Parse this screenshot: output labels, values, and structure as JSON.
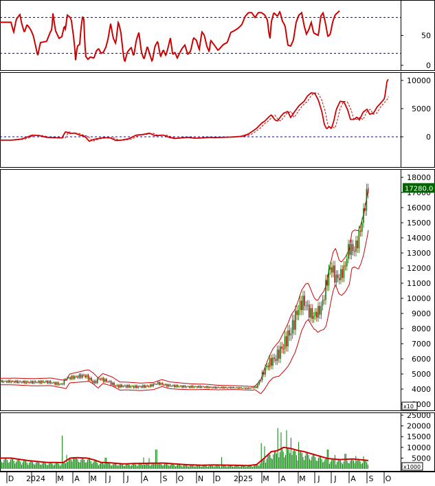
{
  "colors": {
    "line": "#cc0000",
    "guide": "#00008b",
    "up": "#008000",
    "down": "#cc0000",
    "axis": "#000000",
    "price_tag_bg": "#006400",
    "price_tag_fg": "#ffffff"
  },
  "x_axis": {
    "labels": [
      "D",
      "2024",
      "M",
      "A",
      "M",
      "J",
      "J",
      "A",
      "S",
      "O",
      "N",
      "D",
      "2025",
      "M",
      "A",
      "M",
      "J",
      "J",
      "A",
      "S",
      "O"
    ]
  },
  "chart_data": [
    {
      "type": "line",
      "name": "oscillator",
      "ylim": [
        0,
        100
      ],
      "yticks": [
        0,
        50
      ],
      "guides": [
        20,
        80
      ],
      "anchors": [
        [
          0,
          72
        ],
        [
          0.015,
          55
        ],
        [
          0.03,
          77
        ],
        [
          0.05,
          85
        ],
        [
          0.06,
          70
        ],
        [
          0.075,
          55
        ],
        [
          0.09,
          68
        ],
        [
          0.11,
          60
        ],
        [
          0.125,
          50
        ],
        [
          0.14,
          30
        ],
        [
          0.15,
          16
        ],
        [
          0.165,
          38
        ],
        [
          0.2,
          40
        ],
        [
          0.22,
          55
        ],
        [
          0.23,
          60
        ],
        [
          0.235,
          88
        ],
        [
          0.25,
          58
        ],
        [
          0.27,
          45
        ],
        [
          0.29,
          48
        ],
        [
          0.31,
          66
        ],
        [
          0.32,
          60
        ],
        [
          0.335,
          84
        ],
        [
          0.36,
          80
        ],
        [
          0.37,
          75
        ],
        [
          0.39,
          45
        ],
        [
          0.4,
          25
        ],
        [
          0.405,
          8
        ],
        [
          0.42,
          32
        ],
        [
          0.44,
          35
        ],
        [
          0.45,
          60
        ],
        [
          0.465,
          83
        ],
        [
          0.475,
          76
        ],
        [
          0.48,
          50
        ],
        [
          0.49,
          15
        ],
        [
          0.51,
          10
        ],
        [
          0.52,
          12
        ],
        [
          0.53,
          14
        ],
        [
          0.56,
          12
        ],
        [
          0.58,
          24
        ],
        [
          0.6,
          28
        ],
        [
          0.62,
          20
        ],
        [
          0.64,
          22
        ],
        [
          0.66,
          30
        ],
        [
          0.68,
          45
        ],
        [
          0.7,
          70
        ],
        [
          0.72,
          46
        ],
        [
          0.74,
          36
        ],
        [
          0.76,
          73
        ],
        [
          0.78,
          55
        ],
        [
          0.8,
          16
        ],
        [
          0.81,
          5
        ],
        [
          0.83,
          22
        ],
        [
          0.86,
          30
        ],
        [
          0.88,
          15
        ],
        [
          0.9,
          42
        ],
        [
          0.92,
          55
        ],
        [
          0.94,
          22
        ],
        [
          0.96,
          10
        ],
        [
          0.97,
          18
        ],
        [
          0.985,
          32
        ],
        [
          1.0,
          20
        ],
        [
          1.02,
          6
        ],
        [
          1.04,
          32
        ],
        [
          1.06,
          40
        ],
        [
          1.08,
          14
        ],
        [
          1.1,
          26
        ],
        [
          1.12,
          16
        ],
        [
          1.14,
          30
        ],
        [
          1.16,
          46
        ],
        [
          1.18,
          18
        ],
        [
          1.2,
          22
        ],
        [
          1.22,
          12
        ],
        [
          1.24,
          20
        ],
        [
          1.26,
          28
        ],
        [
          1.28,
          34
        ],
        [
          1.3,
          18
        ],
        [
          1.32,
          24
        ],
        [
          1.34,
          46
        ],
        [
          1.36,
          42
        ],
        [
          1.38,
          26
        ],
        [
          1.4,
          56
        ],
        [
          1.42,
          50
        ],
        [
          1.44,
          32
        ],
        [
          1.46,
          22
        ],
        [
          1.47,
          42
        ],
        [
          1.5,
          34
        ],
        [
          1.53,
          25
        ],
        [
          1.56,
          35
        ],
        [
          1.58,
          38
        ],
        [
          1.6,
          55
        ],
        [
          1.62,
          58
        ],
        [
          1.64,
          62
        ],
        [
          1.66,
          68
        ],
        [
          1.68,
          82
        ],
        [
          1.7,
          88
        ],
        [
          1.72,
          88
        ],
        [
          1.74,
          80
        ],
        [
          1.76,
          88
        ],
        [
          1.78,
          88
        ],
        [
          1.8,
          84
        ],
        [
          1.82,
          75
        ],
        [
          1.83,
          55
        ],
        [
          1.84,
          44
        ],
        [
          1.85,
          72
        ],
        [
          1.87,
          88
        ],
        [
          1.9,
          82
        ],
        [
          1.92,
          90
        ],
        [
          1.94,
          74
        ],
        [
          1.96,
          66
        ],
        [
          1.98,
          34
        ],
        [
          2.0,
          32
        ],
        [
          2.02,
          42
        ],
        [
          2.04,
          72
        ],
        [
          2.06,
          84
        ],
        [
          2.08,
          88
        ],
        [
          2.1,
          66
        ],
        [
          2.12,
          52
        ],
        [
          2.14,
          60
        ],
        [
          2.16,
          72
        ],
        [
          2.18,
          54
        ],
        [
          2.2,
          52
        ],
        [
          2.22,
          50
        ],
        [
          2.24,
          82
        ],
        [
          2.26,
          88
        ],
        [
          2.28,
          70
        ],
        [
          2.3,
          48
        ],
        [
          2.32,
          52
        ],
        [
          2.34,
          72
        ],
        [
          2.36,
          84
        ],
        [
          2.38,
          88
        ],
        [
          2.4,
          92
        ]
      ]
    },
    {
      "type": "line",
      "name": "momentum",
      "ylim": [
        -5000,
        10000
      ],
      "yticks": [
        0,
        5000,
        10000
      ],
      "guides": [
        0
      ],
      "anchors": [
        [
          0,
          -600
        ],
        [
          0.06,
          -400
        ],
        [
          0.12,
          300
        ],
        [
          0.16,
          200
        ],
        [
          0.2,
          -100
        ],
        [
          0.24,
          -150
        ],
        [
          0.29,
          -200
        ],
        [
          0.32,
          900
        ],
        [
          0.36,
          600
        ],
        [
          0.4,
          650
        ],
        [
          0.44,
          300
        ],
        [
          0.48,
          100
        ],
        [
          0.5,
          -300
        ],
        [
          0.52,
          -800
        ],
        [
          0.56,
          -450
        ],
        [
          0.6,
          -300
        ],
        [
          0.64,
          -150
        ],
        [
          0.7,
          -200
        ],
        [
          0.74,
          -650
        ],
        [
          0.78,
          -600
        ],
        [
          0.84,
          -350
        ],
        [
          0.9,
          300
        ],
        [
          0.95,
          400
        ],
        [
          1.0,
          650
        ],
        [
          1.04,
          200
        ],
        [
          1.1,
          300
        ],
        [
          1.15,
          -100
        ],
        [
          1.2,
          -300
        ],
        [
          1.25,
          -200
        ],
        [
          1.3,
          -100
        ],
        [
          1.35,
          -250
        ],
        [
          1.4,
          -200
        ],
        [
          1.45,
          -100
        ],
        [
          1.5,
          -150
        ],
        [
          1.55,
          -100
        ],
        [
          1.6,
          -50
        ],
        [
          1.65,
          50
        ],
        [
          1.67,
          200
        ],
        [
          1.7,
          500
        ],
        [
          1.75,
          1500
        ],
        [
          1.78,
          2400
        ],
        [
          1.8,
          2800
        ],
        [
          1.83,
          3500
        ],
        [
          1.85,
          3900
        ],
        [
          1.88,
          3000
        ],
        [
          1.9,
          2800
        ],
        [
          1.93,
          3700
        ],
        [
          1.95,
          4200
        ],
        [
          1.98,
          4500
        ],
        [
          2.0,
          3400
        ],
        [
          2.03,
          4500
        ],
        [
          2.06,
          5500
        ],
        [
          2.1,
          6300
        ],
        [
          2.13,
          7300
        ],
        [
          2.16,
          7800
        ],
        [
          2.19,
          7700
        ],
        [
          2.22,
          6500
        ],
        [
          2.25,
          4400
        ],
        [
          2.27,
          2200
        ],
        [
          2.29,
          1400
        ],
        [
          2.31,
          1800
        ],
        [
          2.33,
          1500
        ],
        [
          2.35,
          2800
        ],
        [
          2.37,
          4800
        ],
        [
          2.4,
          6300
        ],
        [
          2.43,
          6200
        ],
        [
          2.46,
          4700
        ],
        [
          2.48,
          3100
        ],
        [
          2.51,
          3100
        ],
        [
          2.53,
          3500
        ],
        [
          2.55,
          3000
        ],
        [
          2.58,
          4400
        ],
        [
          2.61,
          4900
        ],
        [
          2.63,
          4000
        ],
        [
          2.66,
          4200
        ],
        [
          2.69,
          5300
        ],
        [
          2.72,
          6000
        ],
        [
          2.75,
          6800
        ],
        [
          2.77,
          9900
        ],
        [
          2.78,
          10200
        ]
      ]
    },
    {
      "type": "line",
      "name": "price",
      "ylim": [
        3000,
        18000
      ],
      "yticks": [
        3000,
        4000,
        5000,
        6000,
        7000,
        8000,
        9000,
        10000,
        11000,
        12000,
        13000,
        14000,
        15000,
        16000,
        17000,
        18000
      ],
      "last_label": "17280.0",
      "anchors": [
        [
          0,
          4500
        ],
        [
          0.1,
          4450
        ],
        [
          0.2,
          4480
        ],
        [
          0.29,
          4300
        ],
        [
          0.32,
          4700
        ],
        [
          0.4,
          4800
        ],
        [
          0.48,
          4900
        ],
        [
          0.52,
          4700
        ],
        [
          0.56,
          4400
        ],
        [
          0.6,
          4700
        ],
        [
          0.68,
          4500
        ],
        [
          0.74,
          4200
        ],
        [
          0.8,
          4200
        ],
        [
          0.9,
          4150
        ],
        [
          1.0,
          4200
        ],
        [
          1.06,
          4400
        ],
        [
          1.12,
          4250
        ],
        [
          1.2,
          4200
        ],
        [
          1.3,
          4150
        ],
        [
          1.4,
          4150
        ],
        [
          1.5,
          4100
        ],
        [
          1.6,
          4100
        ],
        [
          1.7,
          4050
        ],
        [
          1.75,
          4150
        ],
        [
          1.77,
          4600
        ],
        [
          1.8,
          5300
        ],
        [
          1.83,
          5700
        ],
        [
          1.86,
          5900
        ],
        [
          1.88,
          6000
        ],
        [
          1.92,
          6500
        ],
        [
          1.95,
          6900
        ],
        [
          1.98,
          7500
        ],
        [
          2.0,
          7800
        ],
        [
          2.02,
          8300
        ],
        [
          2.05,
          9200
        ],
        [
          2.08,
          9700
        ],
        [
          2.1,
          9800
        ],
        [
          2.13,
          9300
        ],
        [
          2.15,
          9000
        ],
        [
          2.18,
          8800
        ],
        [
          2.2,
          9000
        ],
        [
          2.23,
          9200
        ],
        [
          2.25,
          9500
        ],
        [
          2.28,
          10700
        ],
        [
          2.31,
          11800
        ],
        [
          2.33,
          12100
        ],
        [
          2.36,
          11400
        ],
        [
          2.38,
          11300
        ],
        [
          2.41,
          11600
        ],
        [
          2.44,
          12100
        ],
        [
          2.46,
          13200
        ],
        [
          2.48,
          13300
        ],
        [
          2.51,
          13200
        ],
        [
          2.53,
          13600
        ],
        [
          2.55,
          14200
        ],
        [
          2.58,
          15500
        ],
        [
          2.6,
          16600
        ],
        [
          2.62,
          17300
        ]
      ],
      "bands_offset_anchors": [
        [
          0,
          220
        ],
        [
          0.3,
          260
        ],
        [
          0.5,
          380
        ],
        [
          0.8,
          260
        ],
        [
          1.2,
          220
        ],
        [
          1.6,
          130
        ],
        [
          1.74,
          120
        ],
        [
          1.8,
          700
        ],
        [
          1.9,
          1100
        ],
        [
          2.0,
          1500
        ],
        [
          2.1,
          1300
        ],
        [
          2.2,
          1000
        ],
        [
          2.3,
          1400
        ],
        [
          2.4,
          1100
        ],
        [
          2.5,
          1200
        ],
        [
          2.62,
          1400
        ]
      ]
    },
    {
      "type": "bar",
      "name": "volume",
      "ylim": [
        0,
        25000
      ],
      "yticks": [
        5000,
        10000,
        15000,
        20000,
        25000
      ],
      "scale_label": "x1000",
      "spikes": [
        [
          0.29,
          15500
        ],
        [
          0.33,
          6500
        ],
        [
          0.39,
          5500
        ],
        [
          0.52,
          5200
        ],
        [
          0.66,
          5200
        ],
        [
          0.96,
          5300
        ],
        [
          1.0,
          5000
        ],
        [
          1.05,
          9000
        ],
        [
          1.55,
          5500
        ],
        [
          1.78,
          12000
        ],
        [
          1.8,
          10500
        ],
        [
          1.9,
          19000
        ],
        [
          1.93,
          17000
        ],
        [
          1.97,
          18000
        ],
        [
          2.0,
          14500
        ],
        [
          2.06,
          12500
        ],
        [
          2.3,
          9000
        ],
        [
          2.36,
          6500
        ],
        [
          2.44,
          7000
        ],
        [
          2.52,
          6000
        ],
        [
          2.58,
          5800
        ]
      ],
      "ma_anchors": [
        [
          0,
          5000
        ],
        [
          0.1,
          3800
        ],
        [
          0.2,
          3000
        ],
        [
          0.3,
          2900
        ],
        [
          0.36,
          5000
        ],
        [
          0.42,
          5200
        ],
        [
          0.5,
          5000
        ],
        [
          0.56,
          4200
        ],
        [
          0.62,
          3000
        ],
        [
          0.7,
          2800
        ],
        [
          0.8,
          2300
        ],
        [
          0.9,
          2500
        ],
        [
          1.0,
          2600
        ],
        [
          1.1,
          2700
        ],
        [
          1.2,
          2300
        ],
        [
          1.3,
          1900
        ],
        [
          1.4,
          1700
        ],
        [
          1.5,
          1800
        ],
        [
          1.6,
          1700
        ],
        [
          1.7,
          1500
        ],
        [
          1.75,
          2000
        ],
        [
          1.8,
          5200
        ],
        [
          1.85,
          8000
        ],
        [
          1.9,
          8500
        ],
        [
          1.95,
          10000
        ],
        [
          2.0,
          9500
        ],
        [
          2.05,
          8600
        ],
        [
          2.1,
          8000
        ],
        [
          2.2,
          6400
        ],
        [
          2.3,
          4800
        ],
        [
          2.4,
          4300
        ],
        [
          2.5,
          4600
        ],
        [
          2.6,
          4000
        ],
        [
          2.62,
          3900
        ]
      ]
    }
  ]
}
